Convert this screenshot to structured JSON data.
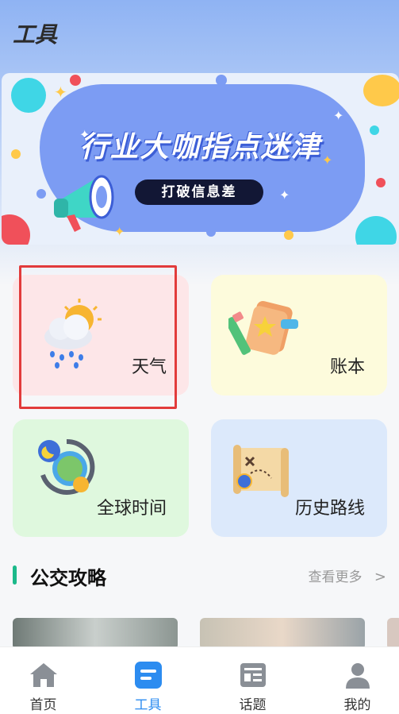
{
  "header": {
    "title": "工具"
  },
  "banner": {
    "title": "行业大咖指点迷津",
    "subtitle": "打破信息差"
  },
  "tools": [
    {
      "label": "天气",
      "icon": "weather-icon",
      "bg": "#fde6e8"
    },
    {
      "label": "账本",
      "icon": "notebook-icon",
      "bg": "#fdfbdc"
    },
    {
      "label": "全球时间",
      "icon": "world-clock-icon",
      "bg": "#dff8de"
    },
    {
      "label": "历史路线",
      "icon": "map-scroll-icon",
      "bg": "#dce9fb"
    }
  ],
  "section": {
    "title": "公交攻略",
    "more": "查看更多",
    "more_icon": "chevron-right-icon"
  },
  "tabbar": {
    "items": [
      {
        "label": "首页",
        "icon": "home-icon"
      },
      {
        "label": "工具",
        "icon": "tools-icon",
        "active": true
      },
      {
        "label": "话题",
        "icon": "topic-icon"
      },
      {
        "label": "我的",
        "icon": "profile-icon"
      }
    ]
  },
  "colors": {
    "accent": "#2c8cf0",
    "section_bar": "#1bb98a",
    "highlight_border": "#e23b3b"
  }
}
